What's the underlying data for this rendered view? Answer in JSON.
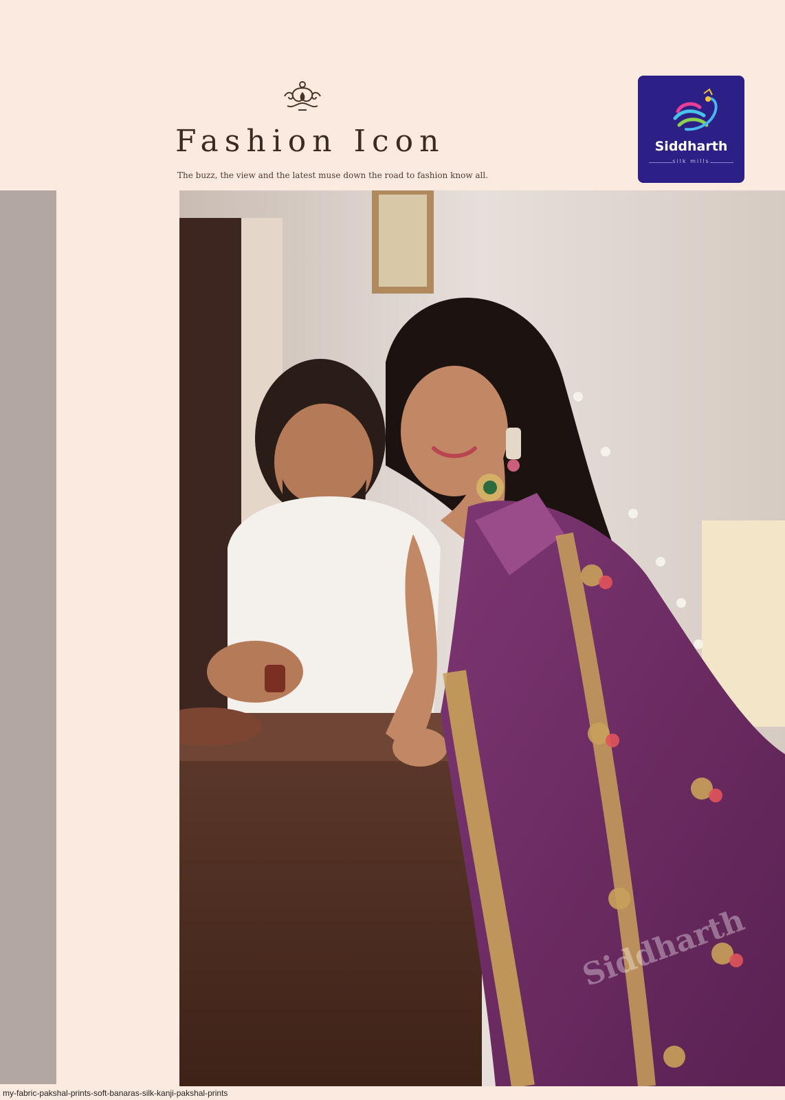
{
  "header": {
    "title": "Fashion Icon",
    "tagline": "The buzz, the view and the latest muse down the road to fashion know all."
  },
  "logo": {
    "name": "Siddharth",
    "sub": "silk mills"
  },
  "photo": {
    "watermark": "Siddharth"
  },
  "footer": {
    "caption": "my-fabric-pakshal-prints-soft-banaras-silk-kanji-pakshal-prints"
  },
  "colors": {
    "background": "#fbeadf",
    "side_strip": "#b3a7a2",
    "logo_bg": "#2c1f86",
    "saree": "#6d2b63",
    "zari_gold": "#c9a15a"
  }
}
